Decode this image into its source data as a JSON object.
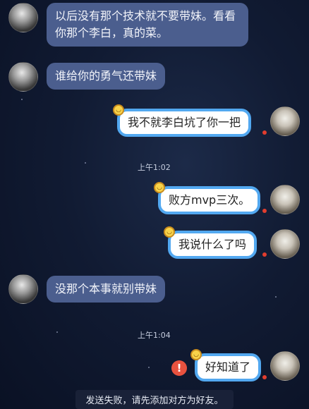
{
  "messages": {
    "m1": "以后没有那个技术就不要带妹。看看你那个李白，真的菜。",
    "m2": "谁给你的勇气还带妹",
    "m3": "我不就李白坑了你一把",
    "t1": "上午1:02",
    "m4": "败方mvp三次。",
    "m5": "我说什么了吗",
    "m6": "没那个本事就别带妹",
    "t2": "上午1:04",
    "m7": "好知道了"
  },
  "error_icon_glyph": "!",
  "notice": "发送失败，请先添加对方为好友。",
  "colors": {
    "incoming_bubble": "#4b5e8e",
    "outgoing_border": "#52a8f0",
    "error": "#e8523f"
  }
}
